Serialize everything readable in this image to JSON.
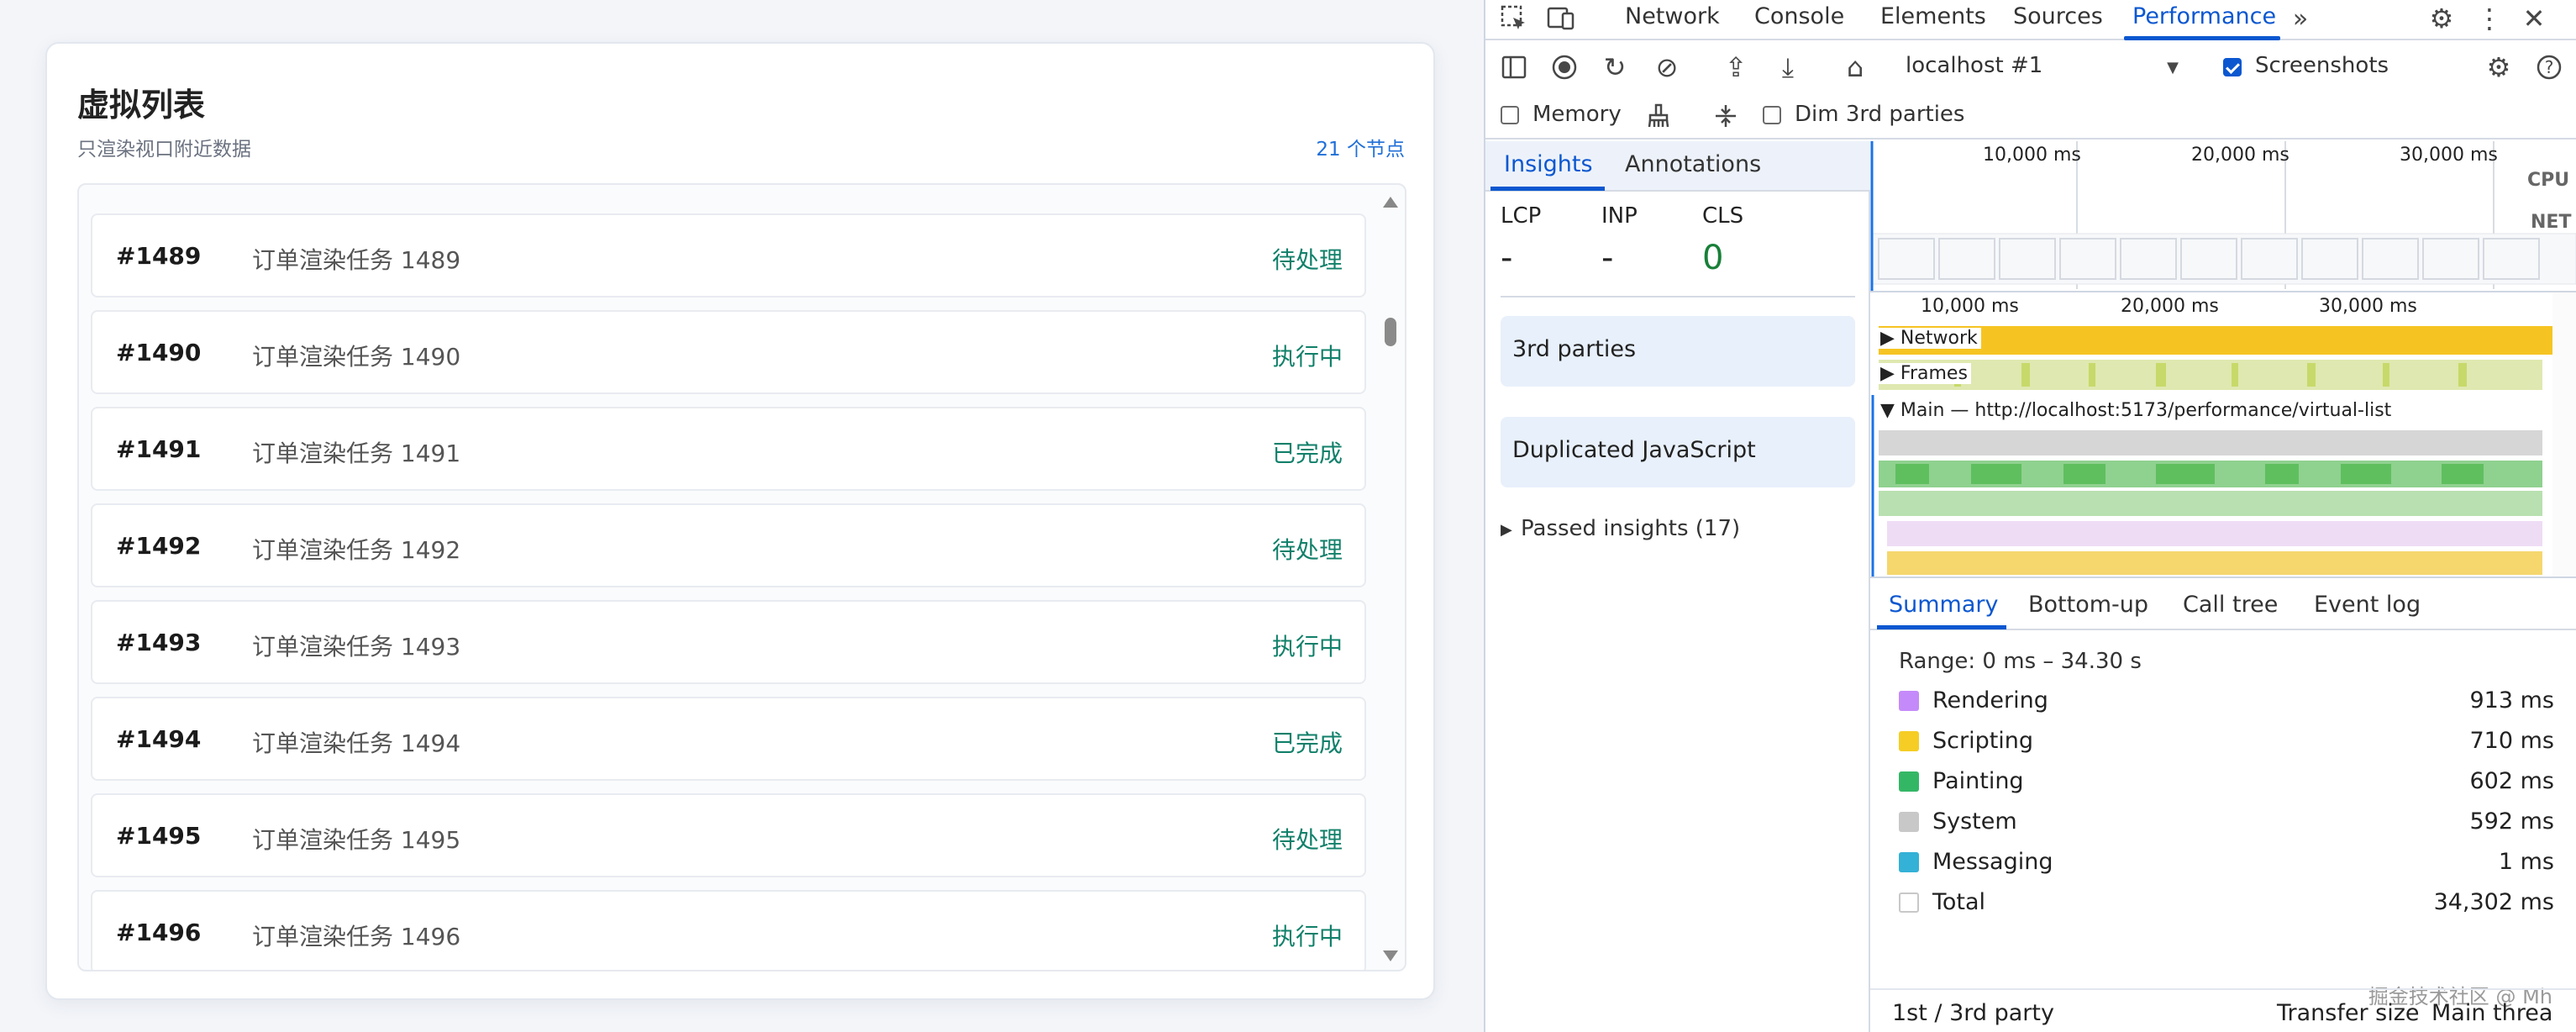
{
  "app": {
    "title": "虚拟列表",
    "subtitle": "只渲染视口附近数据",
    "node_count": "21 个节点",
    "rows": [
      {
        "id": "#1489",
        "name": "订单渲染任务 1489",
        "status": "待处理"
      },
      {
        "id": "#1490",
        "name": "订单渲染任务 1490",
        "status": "执行中"
      },
      {
        "id": "#1491",
        "name": "订单渲染任务 1491",
        "status": "已完成"
      },
      {
        "id": "#1492",
        "name": "订单渲染任务 1492",
        "status": "待处理"
      },
      {
        "id": "#1493",
        "name": "订单渲染任务 1493",
        "status": "执行中"
      },
      {
        "id": "#1494",
        "name": "订单渲染任务 1494",
        "status": "已完成"
      },
      {
        "id": "#1495",
        "name": "订单渲染任务 1495",
        "status": "待处理"
      },
      {
        "id": "#1496",
        "name": "订单渲染任务 1496",
        "status": "执行中"
      }
    ]
  },
  "devtools": {
    "tabs": [
      "Network",
      "Console",
      "Elements",
      "Sources",
      "Performance"
    ],
    "active_tab": "Performance",
    "toolbar": {
      "target": "localhost #1",
      "screenshots_label": "Screenshots",
      "screenshots_checked": true,
      "memory_label": "Memory",
      "memory_checked": false,
      "dim_label": "Dim 3rd parties",
      "dim_checked": false
    },
    "insights": {
      "tabs": [
        "Insights",
        "Annotations"
      ],
      "metrics": [
        {
          "label": "LCP",
          "value": "-"
        },
        {
          "label": "INP",
          "value": "-"
        },
        {
          "label": "CLS",
          "value": "0"
        }
      ],
      "cards": [
        "3rd parties",
        "Duplicated JavaScript"
      ],
      "passed": "Passed insights (17)"
    },
    "timeline": {
      "overview_ticks": [
        "10,000 ms",
        "20,000 ms",
        "30,000 ms"
      ],
      "main_ticks": [
        "10,000 ms",
        "20,000 ms",
        "30,000 ms"
      ],
      "side_labels": [
        "CPU",
        "NET"
      ],
      "tracks": {
        "network": "Network",
        "frames": "Frames",
        "main": "Main — http://localhost:5173/performance/virtual-list"
      }
    },
    "summary": {
      "tabs": [
        "Summary",
        "Bottom-up",
        "Call tree",
        "Event log"
      ],
      "range": "Range: 0 ms – 34.30 s",
      "items": [
        {
          "name": "Rendering",
          "value": "913 ms",
          "color": "#c58af9"
        },
        {
          "name": "Scripting",
          "value": "710 ms",
          "color": "#f5cd25"
        },
        {
          "name": "Painting",
          "value": "602 ms",
          "color": "#34b765"
        },
        {
          "name": "System",
          "value": "592 ms",
          "color": "#c8c8c8"
        },
        {
          "name": "Messaging",
          "value": "1 ms",
          "color": "#34b1d6"
        },
        {
          "name": "Total",
          "value": "34,302 ms",
          "color": "#ffffff"
        }
      ],
      "footer": {
        "party": "1st / 3rd party",
        "transfer": "Transfer size",
        "main": "Main threa"
      }
    },
    "watermark": "掘金技术社区 @ Mh"
  }
}
